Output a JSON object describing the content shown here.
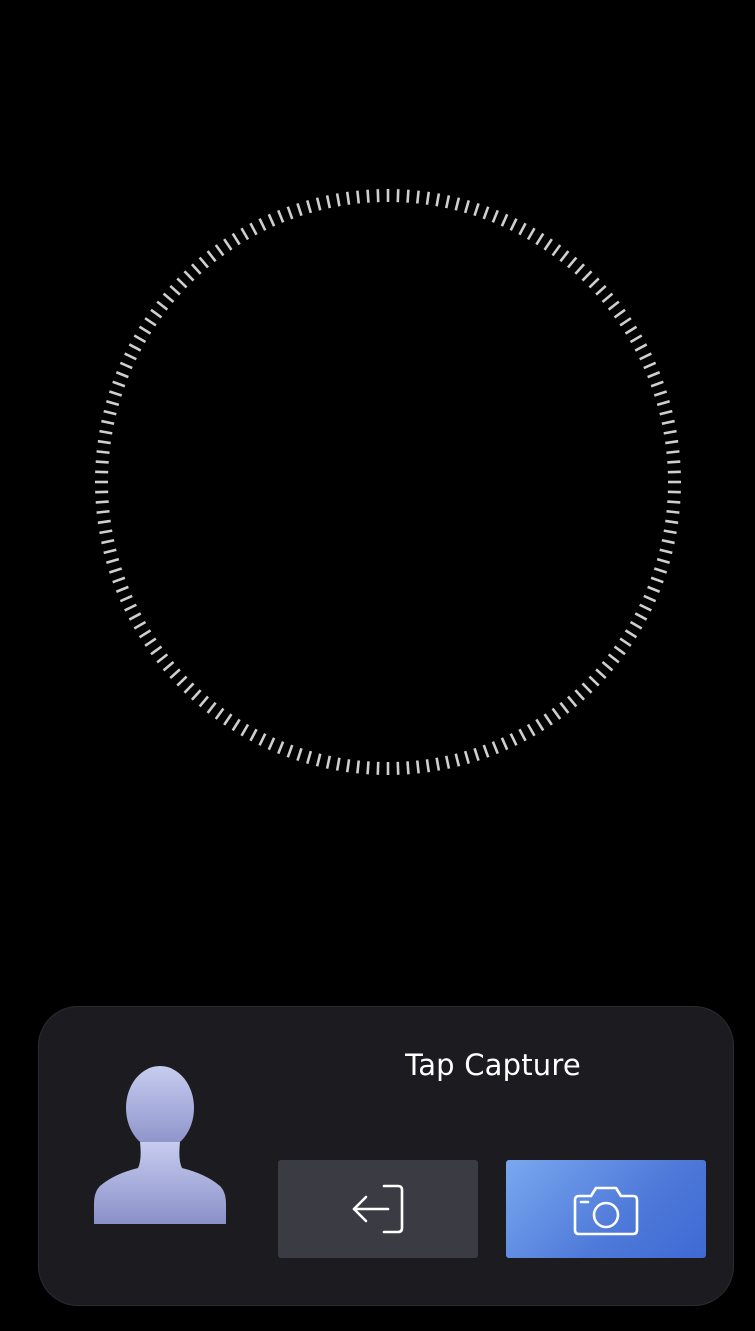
{
  "capture_panel": {
    "prompt": "Tap Capture"
  },
  "icons": {
    "avatar": "person-silhouette-icon",
    "exit": "exit-arrow-icon",
    "capture": "camera-icon"
  },
  "colors": {
    "background": "#000000",
    "panel": "#1c1c20",
    "exit_button": "#3b3b44",
    "capture_button": "#5a85e0",
    "ring": "#cfcfcf"
  }
}
